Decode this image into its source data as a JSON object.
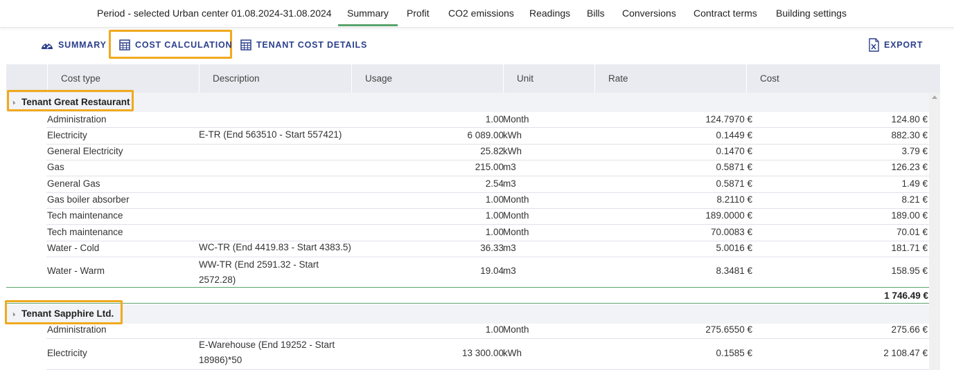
{
  "header": {
    "period": "Period - selected Urban center 01.08.2024-31.08.2024",
    "tabs": [
      "Summary",
      "Profit",
      "CO2 emissions",
      "Readings",
      "Bills",
      "Conversions",
      "Contract terms",
      "Building settings"
    ],
    "active_tab": "Summary"
  },
  "toolbar": {
    "summary": "SUMMARY",
    "cost_calculation": "COST CALCULATION",
    "tenant_cost_details": "TENANT COST DETAILS",
    "export": "EXPORT"
  },
  "colors": {
    "accent_green": "#5aa36c",
    "toolbar_blue": "#2b3f8c",
    "highlight_orange": "#f0a91e"
  },
  "grid": {
    "columns": [
      "Cost type",
      "Description",
      "Usage",
      "Unit",
      "Rate",
      "Cost"
    ],
    "groups": [
      {
        "name": "Tenant Great Restaurant",
        "rows": [
          {
            "type": "Administration",
            "desc": "",
            "usage": "1.00",
            "unit": "Month",
            "rate": "124.7970 €",
            "cost": "124.80 €"
          },
          {
            "type": "Electricity",
            "desc": "E-TR (End 563510 - Start 557421)",
            "usage": "6 089.00",
            "unit": "kWh",
            "rate": "0.1449 €",
            "cost": "882.30 €"
          },
          {
            "type": "General Electricity",
            "desc": "",
            "usage": "25.82",
            "unit": "kWh",
            "rate": "0.1470 €",
            "cost": "3.79 €"
          },
          {
            "type": "Gas",
            "desc": "",
            "usage": "215.00",
            "unit": "m3",
            "rate": "0.5871 €",
            "cost": "126.23 €"
          },
          {
            "type": "General Gas",
            "desc": "",
            "usage": "2.54",
            "unit": "m3",
            "rate": "0.5871 €",
            "cost": "1.49 €"
          },
          {
            "type": "Gas boiler absorber",
            "desc": "",
            "usage": "1.00",
            "unit": "Month",
            "rate": "8.2110 €",
            "cost": "8.21 €"
          },
          {
            "type": "Tech maintenance",
            "desc": "",
            "usage": "1.00",
            "unit": "Month",
            "rate": "189.0000 €",
            "cost": "189.00 €"
          },
          {
            "type": "Tech maintenance",
            "desc": "",
            "usage": "1.00",
            "unit": "Month",
            "rate": "70.0083 €",
            "cost": "70.01 €"
          },
          {
            "type": "Water - Cold",
            "desc": "WC-TR (End 4419.83 - Start 4383.5)",
            "usage": "36.33",
            "unit": "m3",
            "rate": "5.0016 €",
            "cost": "181.71 €"
          },
          {
            "type": "Water - Warm",
            "desc": "WW-TR (End 2591.32 - Start 2572.28)",
            "usage": "19.04",
            "unit": "m3",
            "rate": "8.3481 €",
            "cost": "158.95 €"
          }
        ],
        "total": "1 746.49 €"
      },
      {
        "name": "Tenant Sapphire Ltd.",
        "rows": [
          {
            "type": "Administration",
            "desc": "",
            "usage": "1.00",
            "unit": "Month",
            "rate": "275.6550 €",
            "cost": "275.66 €"
          },
          {
            "type": "Electricity",
            "desc": "E-Warehouse (End 19252 - Start 18986)*50",
            "usage": "13 300.00",
            "unit": "kWh",
            "rate": "0.1585 €",
            "cost": "2 108.47 €"
          }
        ]
      }
    ]
  }
}
